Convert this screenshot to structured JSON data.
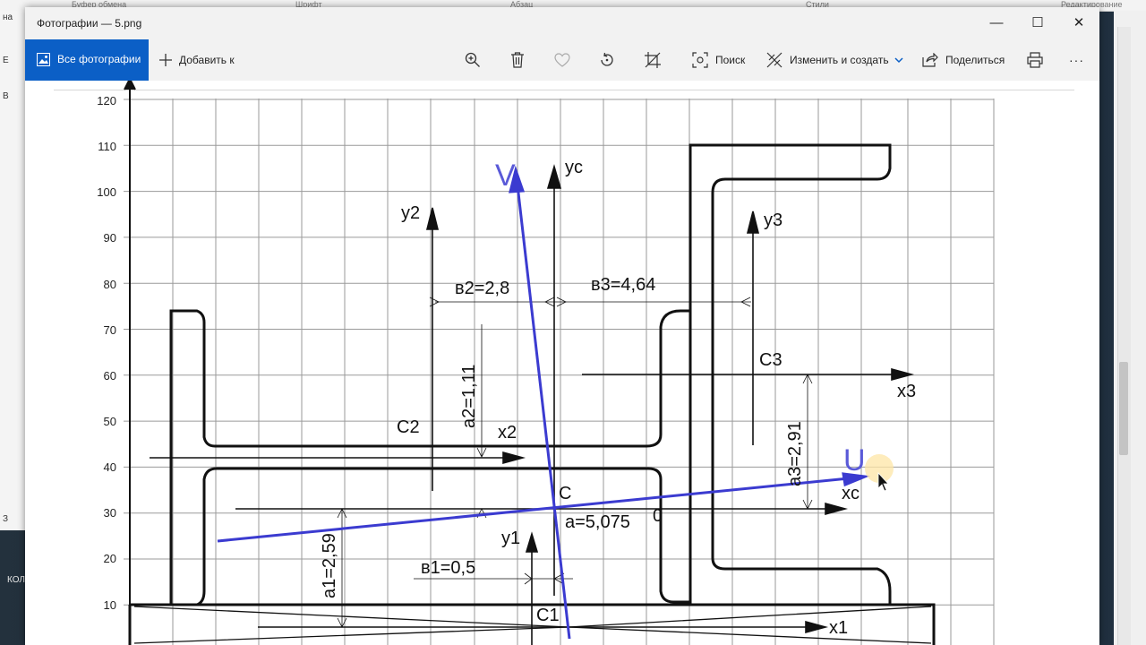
{
  "window": {
    "title": "Фотографии — 5.png",
    "minimize_symbol": "—",
    "maximize_symbol": "☐",
    "close_symbol": "✕"
  },
  "toolbar": {
    "all_photos": "Все фотографии",
    "add_to": "Добавить к",
    "search": "Поиск",
    "edit_create": "Изменить и создать",
    "share": "Поделиться",
    "more": "···",
    "icons": [
      "photos-icon",
      "plus-icon",
      "zoom-icon",
      "trash-icon",
      "heart-icon",
      "rotate-icon",
      "crop-icon",
      "search-people-icon",
      "edit-icon",
      "chevron-down-icon",
      "share-icon",
      "print-icon",
      "more-icon"
    ]
  },
  "background": {
    "ribbon_labels": [
      "Буфер обмена",
      "Шрифт",
      "Абзац",
      "Стили",
      "Редактирование"
    ],
    "left_fragments": [
      "на",
      "Е",
      "В",
      "З"
    ],
    "taskbar_fragment": "КОЛ"
  },
  "drawing": {
    "y_axis_ticks": [
      "120",
      "110",
      "100",
      "90",
      "80",
      "70",
      "60",
      "50",
      "40",
      "30",
      "20",
      "10"
    ],
    "labels": {
      "V": "V",
      "U": "U",
      "yc": "yc",
      "xc": "xc",
      "y2": "y2",
      "x2": "x2",
      "y3": "y3",
      "x3": "x3",
      "y1": "y1",
      "x1": "x1",
      "C": "C",
      "C1": "C1",
      "C2": "C2",
      "C3": "C3",
      "b2": "в2=2,8",
      "b3": "в3=4,64",
      "b1": "в1=0,5",
      "a2": "a2=1,11",
      "a3": "a3=2,91",
      "a1": "a1=2,59",
      "a": "a=5,075",
      "zero": "0"
    },
    "colors": {
      "axis_uv": "#3b3bd0",
      "uv_label": "#5a5ad8",
      "lines": "#111111",
      "grid": "#9a9a9a",
      "cursor_highlight": "#fde6a6"
    }
  }
}
